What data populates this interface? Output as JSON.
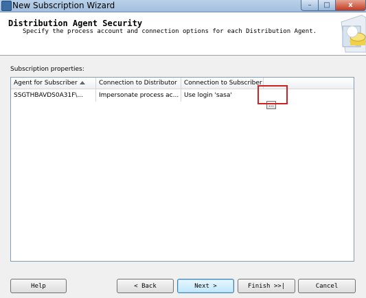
{
  "window": {
    "title": "New Subscription Wizard",
    "close_glyph": "x",
    "min_glyph": "–",
    "max_glyph": "□"
  },
  "header": {
    "title": "Distribution Agent Security",
    "subtitle": "Specify the process account and connection options for each Distribution Agent."
  },
  "subscription": {
    "group_label": "Subscription properties:",
    "columns": [
      "Agent for Subscriber",
      "Connection to Distributor",
      "Connection to Subscriber"
    ],
    "sort_column": "Agent for Subscriber",
    "rows": [
      {
        "agent": "SSGTHBAVDS0A31F\\...",
        "distributor": "Impersonate process ac...",
        "subscriber": "Use login 'sasa'",
        "button_label": "..."
      }
    ]
  },
  "buttons": {
    "help": "Help",
    "back": "< Back",
    "next": "Next >",
    "finish": "Finish >>|",
    "cancel": "Cancel"
  },
  "colors": {
    "highlight_border": "#d02020",
    "title_bar": "#b9d1ea",
    "grid_border": "#7f9db9"
  },
  "icons": {
    "window_icon": "wizard-app-icon",
    "header_graphic": "database-wizard-graphic",
    "sort": "sort-ascending-icon"
  }
}
